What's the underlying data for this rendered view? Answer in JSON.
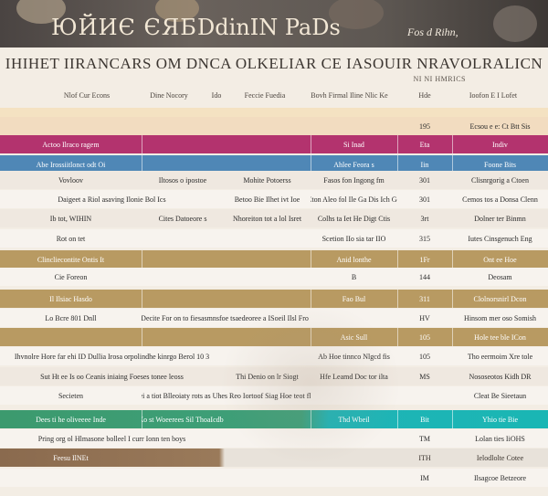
{
  "header": {
    "brand_left": "ЮЙИЄ ЄЯБ",
    "brand_right": "DdinIN PaDs",
    "tag": "Fos d Rihn,"
  },
  "title": "IHIHET IIRANCARS OM DNCA OLKELIAR CE IASOUIR NRAVOLRALICN",
  "subtitle": "NI NI HMRICS",
  "column_headers": [
    "Nlof Cur Econs",
    "Dine Nocory",
    "Ido",
    "Feccie Fuedia",
    "Bovh Firmal Iline Nlic Ke",
    "Hde",
    "Ioofon E I Lofet"
  ],
  "rows": [
    {
      "kind": "highlight",
      "cells": [
        "",
        "",
        "",
        "",
        "",
        "195",
        "Ecsou e e: Ct Btt Sis"
      ]
    },
    {
      "kind": "seg",
      "color": "#b3336e",
      "cells": [
        "Actoo Ilraco ragem",
        "",
        "",
        "",
        "Si Inad",
        "Eta",
        "Indiv"
      ]
    },
    {
      "kind": "seg",
      "color": "#4f87b6",
      "cells": [
        "Abe Irossiitlonct odt Oi",
        "",
        "",
        "",
        "Ahlee Feora s",
        "Iin",
        "Foone Bits"
      ]
    },
    {
      "kind": "alt",
      "cells": [
        "Vovloov",
        "Iltosos o ipostoe",
        "Scvsocow",
        "Mohite Potoerss",
        "Fasos fon Ingong fm",
        "301",
        "Clisnrgorig a Ctoen"
      ]
    },
    {
      "kind": "light",
      "cells": [
        "Daigeet a Riol asaving Ilonie Bol Ics",
        "",
        "Bib Chiet tet",
        "Betoo Bie Ilhet ivt Ioe",
        "Eton Aleo fol Ile Ga Dis Ich Go",
        "301",
        "Cemos tos a Donsa Clenn"
      ]
    },
    {
      "kind": "alt",
      "cells": [
        "Ib tot, WIHIN",
        "Cites Datoeore s",
        "Hre toe colte ct",
        "Nhoreiton tot a lol Isret",
        "Colhs ta Iet He Digt Ctis",
        "3rt",
        "Dolner ter Binmn"
      ]
    },
    {
      "kind": "light",
      "cells": [
        "Rot on tet",
        "",
        "",
        "",
        "Scetion IIo sia tar IIO",
        "315",
        "Iutes Cinsgenuch Eng"
      ]
    },
    {
      "kind": "seg",
      "color": "#b89a62",
      "cells": [
        "Clincliecontite Ontis It",
        "",
        "",
        "",
        "Anid lonthe",
        "1Fr",
        "Ont ee Hoe"
      ]
    },
    {
      "kind": "light",
      "cells": [
        "Cie Foreon",
        "",
        "",
        "",
        "B",
        "144",
        "Deosam"
      ]
    },
    {
      "kind": "seg",
      "color": "#b89a62",
      "cells": [
        "Il Ilsiac Hasdo",
        "",
        "",
        "",
        "Fao Bul",
        "311",
        "Clolnorsnirl Dcon"
      ]
    },
    {
      "kind": "light",
      "cells": [
        "Lo Bcre 801 Dnll",
        "Vis teseon Decite For on to fiesasmnsfoe tsaedeoree a ISoeil Ilsl Fro tea/sh/tisoc",
        "",
        "",
        "",
        "HV",
        "Hinsom mer oso Somish"
      ]
    },
    {
      "kind": "seg",
      "color": "#b89a62",
      "cells": [
        "",
        "",
        "",
        "",
        "Asic Sull",
        "105",
        "Hole tee ble ICon"
      ]
    },
    {
      "kind": "light",
      "cells": [
        "Ihvnolre Hore far ehi ID Dullia Irosa orpolindhe kinrgo Berol 10 3",
        "",
        "",
        "",
        "Ab Hoe tinnco Nlgcd fis",
        "105",
        "Tho eermoim Xre tole"
      ]
    },
    {
      "kind": "alt",
      "cells": [
        "Sut Ht ee Is oo Ceanis iniaing Foeses tonee leoss",
        "",
        "",
        "Thi Denio on lr Siogt",
        "Hfe Leamd Doc tor ilta",
        "MS",
        "Nososeotos Kidh DR"
      ]
    },
    {
      "kind": "light",
      "cells": [
        "Secieten",
        "Ilhe teaei a tiot Blleoiaty rots as Uhes Reo Iortoof Siag Hoe teot flon Hole",
        "",
        "",
        "",
        "",
        "Cleat Be Sieetaun"
      ]
    },
    {
      "kind": "seg2",
      "cells": [
        "Dees ti he oliveeee Inde",
        "Ko st Woeerees Sil ThoaIcdbo",
        "",
        "",
        "Thd Wbeil",
        "Bit",
        "Yhio tie Bie"
      ]
    },
    {
      "kind": "light",
      "cells": [
        "Pring org ol Hlmasone bolleel I curr Ionn ten boys",
        "",
        "",
        "",
        "",
        "TM",
        "Lolan ties IiOHS"
      ]
    },
    {
      "kind": "seg3",
      "cells": [
        "Feesu IlNEt",
        "",
        "",
        "",
        "",
        "ITH",
        "Ielodlolte Cotee"
      ]
    },
    {
      "kind": "light",
      "cells": [
        "",
        "",
        "",
        "",
        "",
        "IM",
        "Ilsagcoe Betzeore"
      ]
    }
  ]
}
